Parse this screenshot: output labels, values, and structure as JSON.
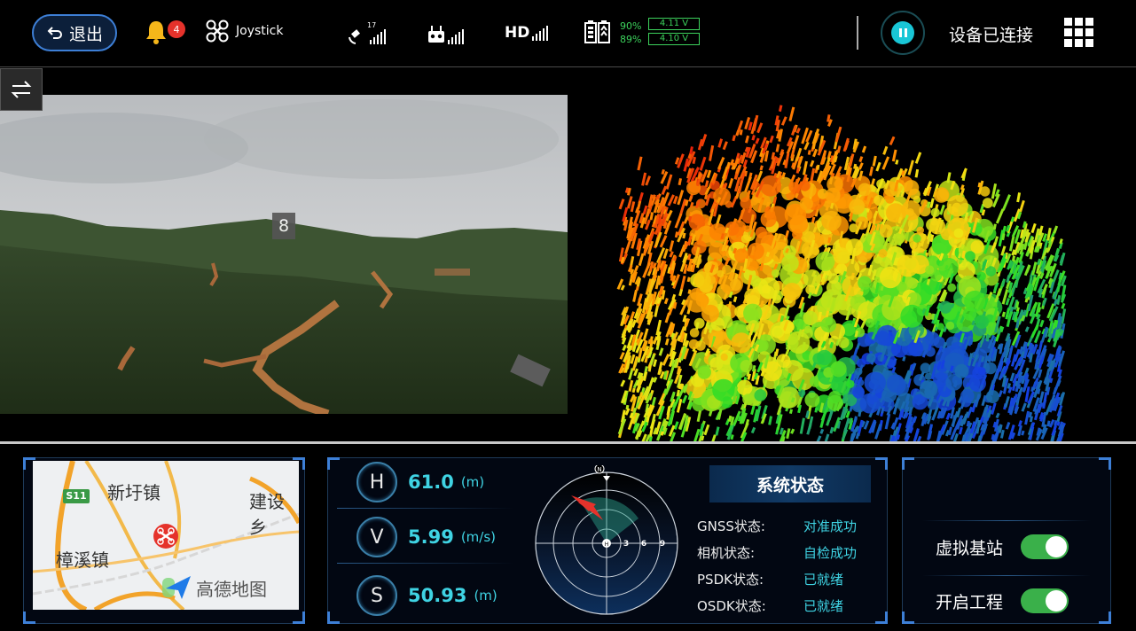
{
  "topbar": {
    "back_label": "退出",
    "notification_count": "4",
    "mode_label": "Joystick",
    "gps_satellites": "17",
    "hd_label": "HD",
    "battery_pct_1": "90%",
    "battery_pct_2": "89%",
    "voltage_1": "4.11 V",
    "voltage_2": "4.10 V",
    "connection_status": "设备已连接"
  },
  "camera": {
    "counter": "8"
  },
  "map": {
    "label_1": "新圩镇",
    "label_2": "建设乡",
    "label_3": "樟溪镇",
    "road_badge": "S11",
    "logo_text": "高德地图"
  },
  "telemetry": {
    "h_label": "H",
    "h_value": "61.0",
    "h_unit": "(m)",
    "v_label": "V",
    "v_value": "5.99",
    "v_unit": "(m/s)",
    "s_label": "S",
    "s_value": "50.93",
    "s_unit": "(m)",
    "compass_n": "N",
    "radar_marks": [
      "3",
      "6",
      "9"
    ]
  },
  "system_status": {
    "title": "系统状态",
    "rows": [
      {
        "key": "GNSS状态:",
        "value": "对准成功"
      },
      {
        "key": "相机状态:",
        "value": "自检成功"
      },
      {
        "key": "PSDK状态:",
        "value": "已就绪"
      },
      {
        "key": "OSDK状态:",
        "value": "已就绪"
      }
    ]
  },
  "controls": {
    "virtual_base_label": "虚拟基站",
    "virtual_base_on": true,
    "open_project_label": "开启工程",
    "open_project_on": true
  },
  "colors": {
    "accent": "#3d7fd6",
    "teal": "#3fd3e3",
    "ok_green": "#3cd25c",
    "toggle_green": "#3ab04a",
    "badge_red": "#e5322b"
  }
}
